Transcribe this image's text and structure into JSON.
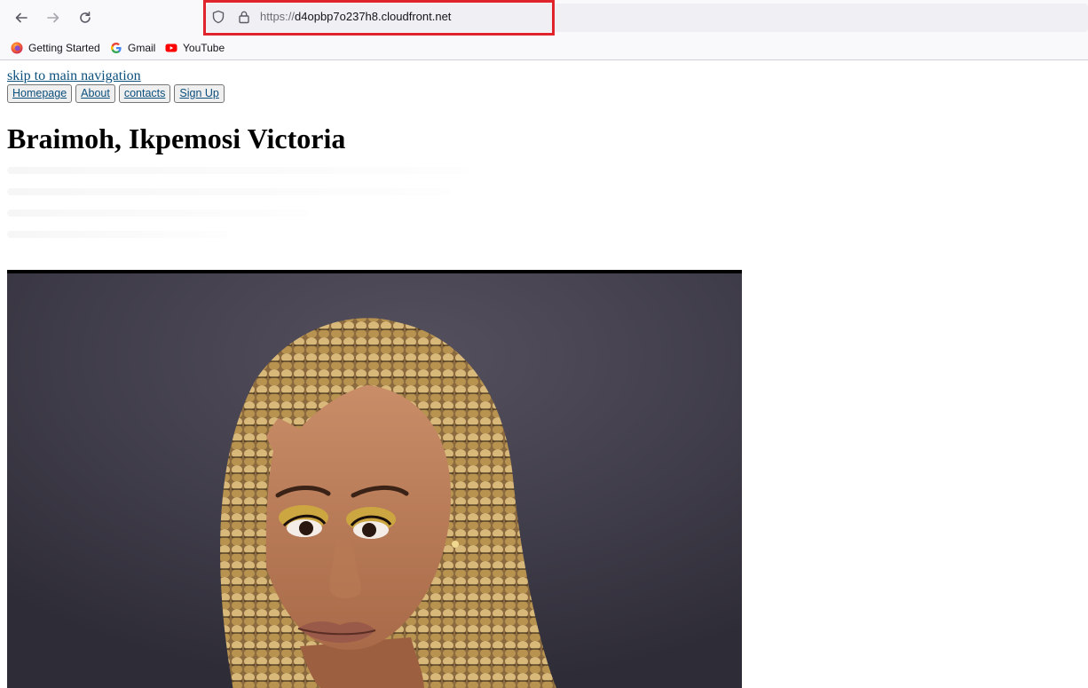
{
  "browser": {
    "url_scheme": "https://",
    "url_host": "d4opbp7o237h8.cloudfront.net",
    "bookmarks": [
      {
        "label": "Getting Started",
        "icon": "firefox-icon"
      },
      {
        "label": "Gmail",
        "icon": "google-icon"
      },
      {
        "label": "YouTube",
        "icon": "youtube-icon"
      }
    ],
    "highlight_color": "#e0242b"
  },
  "page": {
    "skip_link": "skip to main navigation",
    "nav": [
      "Homepage",
      "About",
      "contacts",
      "Sign Up"
    ],
    "title": "Braimoh, Ikpemosi Victoria",
    "link_color": "#0b4f7d"
  },
  "photo": {
    "subject": "portrait-photo"
  }
}
